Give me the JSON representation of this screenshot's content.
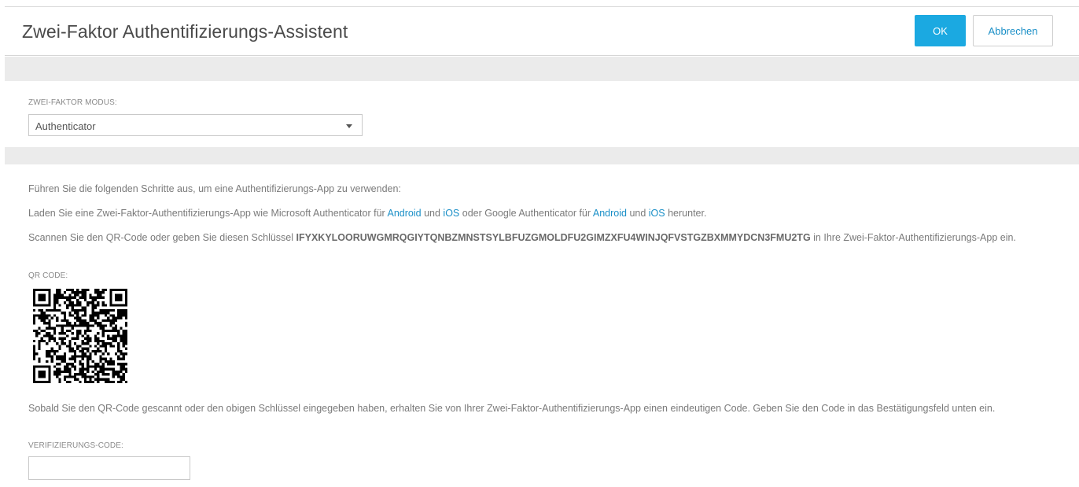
{
  "header": {
    "title": "Zwei-Faktor Authentifizierungs-Assistent",
    "ok_label": "OK",
    "cancel_label": "Abbrechen"
  },
  "mode": {
    "label": "ZWEI-FAKTOR MODUS:",
    "selected": "Authenticator"
  },
  "instructions": {
    "intro": "Führen Sie die folgenden Schritte aus, um eine Authentifizierungs-App zu verwenden:",
    "download_prefix": "Laden Sie eine Zwei-Faktor-Authentifizierungs-App wie Microsoft Authenticator für",
    "link_android_1": "Android",
    "and_1": "und",
    "link_ios_1": "iOS",
    "download_middle": "oder Google Authenticator für",
    "link_android_2": "Android",
    "and_2": "und",
    "link_ios_2": "iOS",
    "download_suffix": "herunter.",
    "scan_prefix": "Scannen Sie den QR-Code oder geben Sie diesen Schlüssel",
    "secret_key": "IFYXKYLOORUWGMRQGIYTQNBZMNSTSYLBFUZGMOLDFU2GIMZXFU4WINJQFVSTGZBXMMYDCN3FMU2TG",
    "scan_suffix": "in Ihre Zwei-Faktor-Authentifizierungs-App ein.",
    "qr_label": "QR CODE:",
    "after_scan": "Sobald Sie den QR-Code gescannt oder den obigen Schlüssel eingegeben haben, erhalten Sie von Ihrer Zwei-Faktor-Authentifizierungs-App einen eindeutigen Code. Geben Sie den Code in das Bestätigungsfeld unten ein."
  },
  "verification": {
    "label": "VERIFIZIERUNGS-CODE:",
    "value": ""
  },
  "colors": {
    "primary": "#1ba9e1",
    "link": "#1a8fc7",
    "band": "#ebebeb"
  }
}
